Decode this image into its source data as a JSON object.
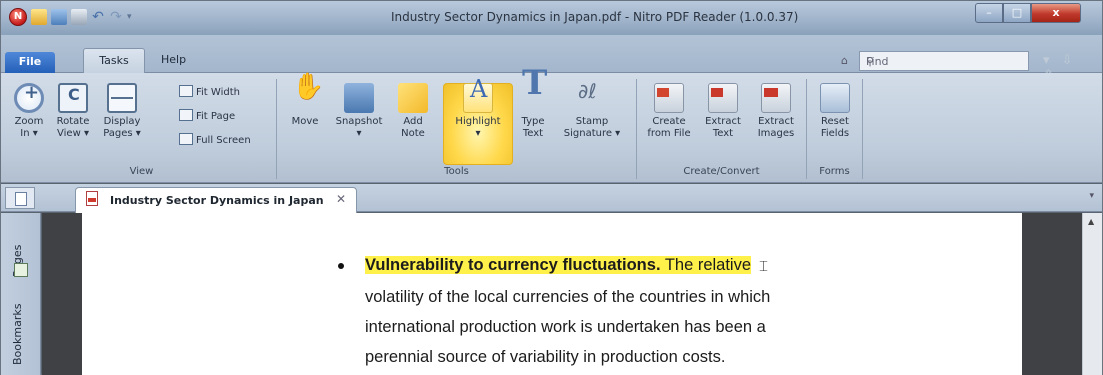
{
  "window": {
    "title": "Industry Sector Dynamics in Japan.pdf - Nitro PDF Reader (1.0.0.37)",
    "app_logo_letter": "N",
    "controls": {
      "minimize": "–",
      "maximize": "□",
      "close": "x"
    }
  },
  "quick_access": {
    "icons": [
      "nitro-logo-icon",
      "open-folder-icon",
      "save-icon",
      "print-icon",
      "undo-icon",
      "redo-icon",
      "qat-dropdown-icon"
    ],
    "undo": "↶",
    "redo": "↷",
    "dropdown": "▾"
  },
  "menu": {
    "file": "File",
    "tasks": "Tasks",
    "help": "Help"
  },
  "search": {
    "placeholder": "Find",
    "home_icon": "⌂",
    "search_icon": "⚲",
    "nav": "▾ ⇩ ⇧"
  },
  "ribbon": {
    "groups": {
      "view": "View",
      "tools": "Tools",
      "create_convert": "Create/Convert",
      "forms": "Forms"
    },
    "buttons": {
      "zoom_in": "Zoom\nIn ▾",
      "rotate_view": "Rotate\nView ▾",
      "display_pages": "Display\nPages ▾",
      "fit_width": "Fit Width",
      "fit_page": "Fit Page",
      "full_screen": "Full Screen",
      "move": "Move",
      "snapshot": "Snapshot\n▾",
      "add_note": "Add\nNote",
      "highlight": "Highlight\n▾",
      "type_text": "Type\nText",
      "stamp_signature": "Stamp\nSignature ▾",
      "create_from_file": "Create\nfrom File",
      "extract_text": "Extract\nText",
      "extract_images": "Extract\nImages",
      "reset_fields": "Reset\nFields"
    }
  },
  "document_tab": {
    "name": "Industry Sector Dynamics in Japan",
    "close": "✕",
    "menu_arrow": "▾"
  },
  "side_panel": {
    "pages": "Pages",
    "bookmarks": "Bookmarks"
  },
  "document": {
    "bullet_heading": "Vulnerability to currency fluctuations.",
    "highlighted_tail": " The relative",
    "cursor": "⌶",
    "lines": [
      "volatility of the local currencies of the countries in which",
      "international production work is undertaken has been a",
      "perennial source of variability in production costs."
    ]
  },
  "scrollbar": {
    "up_arrow": "▲"
  },
  "colors": {
    "highlight": "#fff04a",
    "file_tab": "#2460b8",
    "close_button": "#c0392b"
  }
}
